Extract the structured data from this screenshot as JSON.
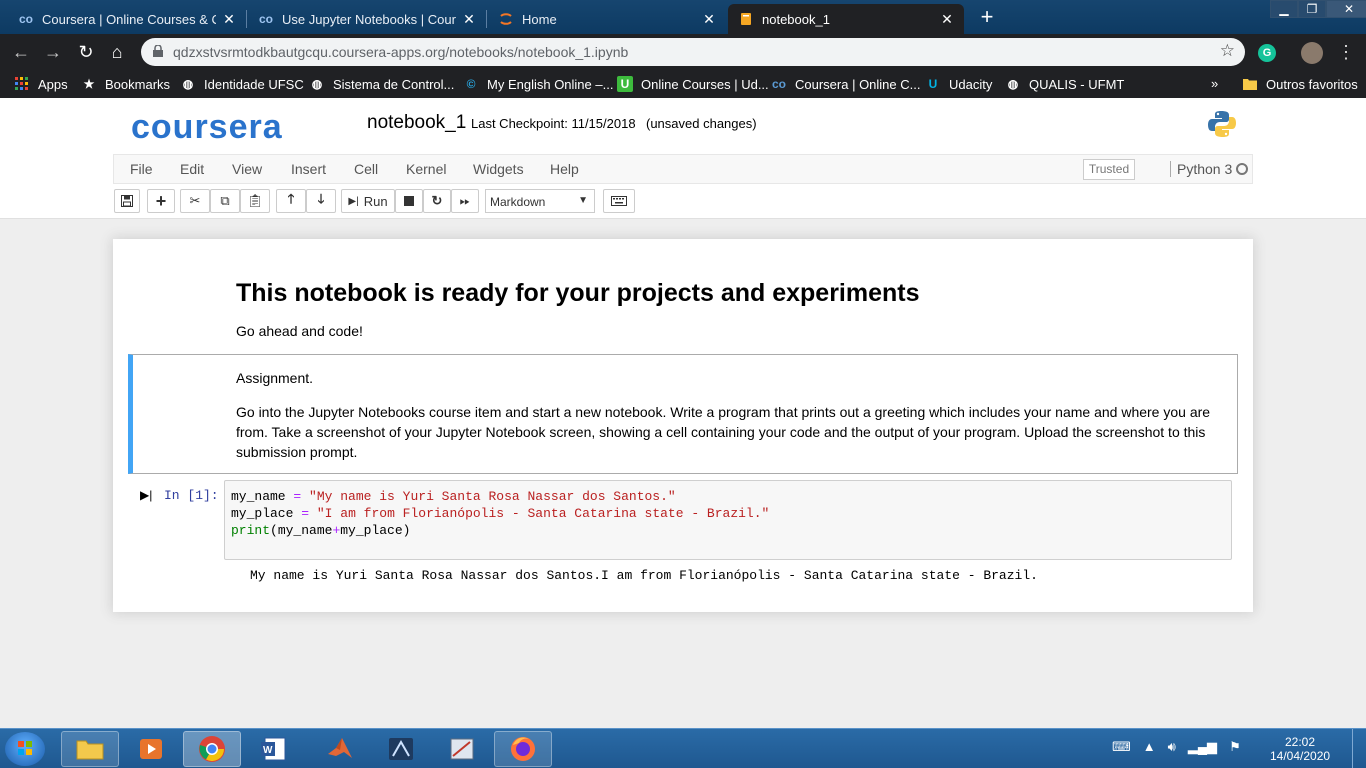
{
  "browser": {
    "tabs": [
      {
        "title": "Coursera | Online Courses & Crec",
        "icon": "coursera-icon",
        "active": false
      },
      {
        "title": "Use Jupyter Notebooks | Courser",
        "icon": "coursera-icon",
        "active": false
      },
      {
        "title": "Home",
        "icon": "jupyter-icon",
        "active": false
      },
      {
        "title": "notebook_1",
        "icon": "notebook-icon",
        "active": true
      }
    ],
    "url": "qdzxstvsrmtodkbautgcqu.coursera-apps.org/notebooks/notebook_1.ipynb",
    "bookmarks": [
      {
        "label": "Apps",
        "icon": "apps-grid-icon"
      },
      {
        "label": "Bookmarks",
        "icon": "star-icon"
      },
      {
        "label": "Identidade UFSC",
        "icon": "globe-icon"
      },
      {
        "label": "Sistema de Control...",
        "icon": "globe-icon"
      },
      {
        "label": "My English Online –...",
        "icon": "meo-icon"
      },
      {
        "label": "Online Courses | Ud...",
        "icon": "udemy-icon"
      },
      {
        "label": "Coursera | Online C...",
        "icon": "coursera-icon"
      },
      {
        "label": "Udacity",
        "icon": "udacity-icon"
      },
      {
        "label": "QUALIS - UFMT",
        "icon": "globe-icon"
      }
    ],
    "more_bookmarks": "»",
    "other_bookmarks": "Outros favoritos"
  },
  "jupyter": {
    "logo": "coursera",
    "notebook_name": "notebook_1",
    "checkpoint": "Last Checkpoint: 11/15/2018",
    "unsaved": "(unsaved changes)",
    "menu": [
      "File",
      "Edit",
      "View",
      "Insert",
      "Cell",
      "Kernel",
      "Widgets",
      "Help"
    ],
    "trusted": "Trusted",
    "kernel": "Python 3",
    "run_label": "Run",
    "cell_type": "Markdown"
  },
  "notebook": {
    "title": "This notebook is ready for your projects and experiments",
    "subtitle": "Go ahead and code!",
    "assignment_heading": "Assignment.",
    "assignment_text": "Go into the Jupyter Notebooks course item and start a new notebook. Write a program that prints out a greeting which includes your name and where you are from. Take a screenshot of your Jupyter Notebook screen, showing a cell containing your code and the output of your program. Upload the screenshot to this submission prompt.",
    "prompt": "In [1]:",
    "code": {
      "line1_var": "my_name",
      "line1_str": "\"My name is Yuri Santa Rosa Nassar dos Santos.\"",
      "line2_var": "my_place",
      "line2_str": "\"I am from Florianópolis - Santa Catarina state - Brazil.\"",
      "line3_fn": "print",
      "line3_args_a": "my_name",
      "line3_args_b": "my_place"
    },
    "output": "My name is Yuri Santa Rosa Nassar dos Santos.I am from Florianópolis - Santa Catarina state - Brazil."
  },
  "taskbar": {
    "apps": [
      "explorer-icon",
      "media-player-icon",
      "chrome-icon",
      "word-icon",
      "matlab-icon",
      "app-icon",
      "app2-icon",
      "firefox-icon"
    ],
    "time": "22:02",
    "date": "14/04/2020"
  },
  "colors": {
    "coursera_blue": "#2a73cc",
    "selected_cell_border": "#42a5f5",
    "prompt_blue": "#303f9f",
    "string_red": "#ba2121",
    "operator_purple": "#aa22ff",
    "builtin_green": "#008000"
  }
}
